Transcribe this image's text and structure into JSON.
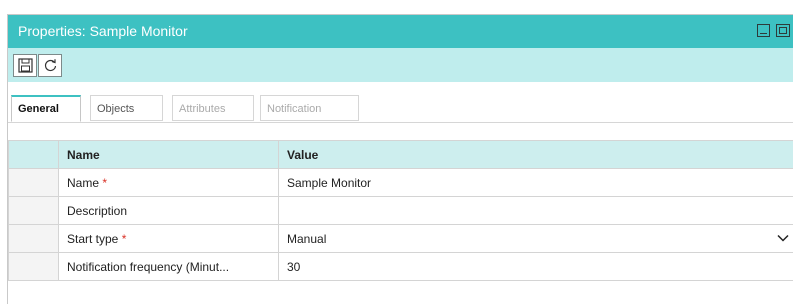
{
  "window": {
    "title": "Properties: Sample Monitor"
  },
  "toolbar": {
    "buttons": [
      {
        "name": "save",
        "icon": "save-icon"
      },
      {
        "name": "refresh",
        "icon": "refresh-icon"
      }
    ]
  },
  "tabs": [
    {
      "label": "General",
      "active": true
    },
    {
      "label": "Objects",
      "active": false
    },
    {
      "label": "Attributes",
      "active": false
    },
    {
      "label": "Notification",
      "active": false
    }
  ],
  "grid": {
    "columns": [
      "Name",
      "Value"
    ],
    "rows": [
      {
        "name": "Name",
        "required": "*",
        "value": "Sample Monitor"
      },
      {
        "name": "Description",
        "required": "",
        "value": ""
      },
      {
        "name": "Start type",
        "required": "*",
        "value": "Manual",
        "has_dropdown": true
      },
      {
        "name": "Notification frequency (Minut...",
        "required": "",
        "value": "30"
      }
    ]
  },
  "colors": {
    "title_bar": "#3dc1c2",
    "toolbar": "#bfeded",
    "grid_header": "#cdeeee",
    "required_marker": "#d93025"
  }
}
